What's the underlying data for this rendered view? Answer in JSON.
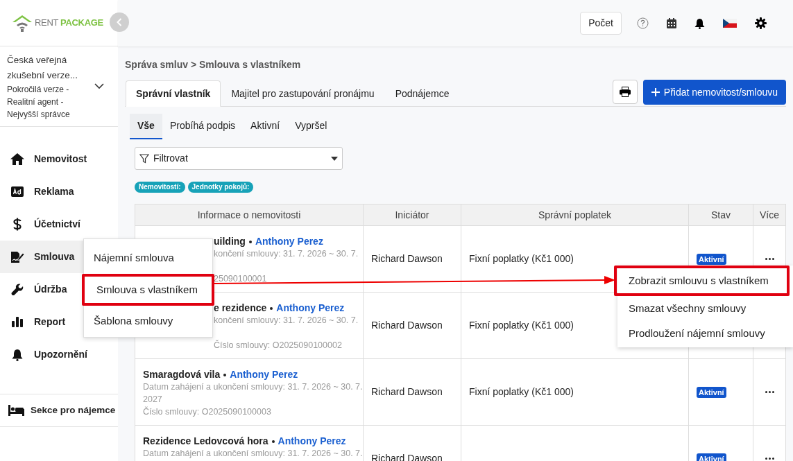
{
  "logo": {
    "words": [
      "RENT",
      "PACKAGE"
    ]
  },
  "account": {
    "name": "Česká veřejná zkušební verze...",
    "role": "Pokročilá verze - Realitní agent - Nejvyšší správce"
  },
  "nav": [
    {
      "label": "Nemovitost",
      "selected": false
    },
    {
      "label": "Reklama",
      "selected": false
    },
    {
      "label": "Účetnictví",
      "selected": false
    },
    {
      "label": "Smlouva",
      "selected": true
    },
    {
      "label": "Údržba",
      "selected": false
    },
    {
      "label": "Report",
      "selected": false
    },
    {
      "label": "Upozornění",
      "selected": false
    }
  ],
  "tenant_section": {
    "label": "Sekce pro nájemce"
  },
  "header": {
    "count_button": "Počet"
  },
  "breadcrumb": "Správa smluv > Smlouva s vlastníkem",
  "tabs": [
    {
      "label": "Správní vlastník",
      "selected": true
    },
    {
      "label": "Majitel pro zastupování pronájmu",
      "selected": false
    },
    {
      "label": "Podnájemce",
      "selected": false
    }
  ],
  "add_button": "Přidat nemovitost/smlouvu",
  "subtabs": [
    {
      "label": "Vše",
      "selected": true
    },
    {
      "label": "Probíhá podpis",
      "selected": false
    },
    {
      "label": "Aktivní",
      "selected": false
    },
    {
      "label": "Vypršel",
      "selected": false
    }
  ],
  "filter": {
    "label": "Filtrovat"
  },
  "filter_tags": [
    "Nemovitostí:",
    "Jednotky pokojů:"
  ],
  "table": {
    "columns": [
      "Informace o nemovitosti",
      "Iniciátor",
      "Správní poplatek",
      "Stav",
      "Více"
    ],
    "rows": [
      {
        "partly_covered": true,
        "title": "uilding",
        "owner": "Anthony Perez",
        "date": "končení smlouvy: 31. 7. 2026 ~ 30. 7.",
        "number": "25090100001",
        "initiator": "Richard Dawson",
        "fee": "Fixní poplatky (Kč1 000)",
        "status": "Aktivní",
        "more": true
      },
      {
        "partly_covered": true,
        "title": "e rezidence",
        "owner": "Anthony Perez",
        "date": "končení smlouvy: 31. 7. 2026 ~ 30. 7.",
        "number": "Číslo smlouvy: O2025090100002",
        "initiator": "Richard Dawson",
        "fee": "Fixní poplatky (Kč1 000)",
        "more": false
      },
      {
        "partly_covered": false,
        "title": "Smaragdová vila",
        "owner": "Anthony Perez",
        "date": "Datum zahájení a ukončení smlouvy: 31. 7. 2026 ~ 30. 7.",
        "year": "2027",
        "number": "Číslo smlouvy: O2025090100003",
        "initiator": "Richard Dawson",
        "fee": "Fixní poplatky (Kč1 000)",
        "status": "Aktivní",
        "more": true
      },
      {
        "partly_covered": false,
        "title": "Rezidence Ledovcová hora",
        "owner": "Anthony Perez",
        "date": "Datum zahájení a ukončení smlouvy: 31. 7. 2026 ~ 30. 7.",
        "initiator": "Richard Dawson",
        "status": "Aktivní",
        "more": true
      }
    ]
  },
  "submenu": {
    "items": [
      {
        "label": "Nájemní smlouva",
        "highlighted": false
      },
      {
        "label": "Smlouva s vlastníkem",
        "highlighted": true
      },
      {
        "label": "Šablona smlouvy",
        "highlighted": false
      }
    ]
  },
  "row_menu": {
    "items": [
      {
        "label": "Zobrazit smlouvu s vlastníkem",
        "highlighted": true
      },
      {
        "label": "Smazat všechny smlouvy",
        "highlighted": false
      },
      {
        "label": "Prodloužení nájemní smlouvy",
        "highlighted": false
      }
    ]
  }
}
